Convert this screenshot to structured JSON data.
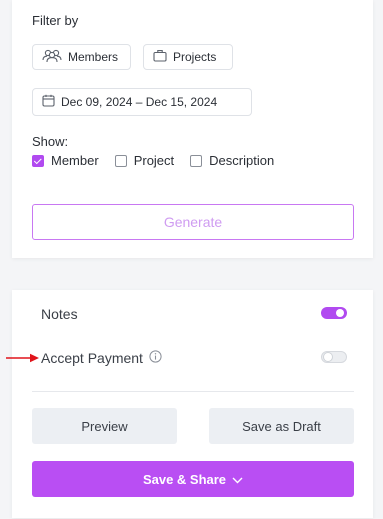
{
  "filter": {
    "label": "Filter by",
    "members_chip": "Members",
    "projects_chip": "Projects",
    "date_range": "Dec 09, 2024 – Dec 15, 2024"
  },
  "show": {
    "label": "Show:",
    "options": [
      {
        "label": "Member",
        "checked": true
      },
      {
        "label": "Project",
        "checked": false
      },
      {
        "label": "Description",
        "checked": false
      }
    ]
  },
  "generate_label": "Generate",
  "settings": {
    "notes_label": "Notes",
    "notes_enabled": true,
    "accept_payment_label": "Accept Payment",
    "accept_payment_enabled": false
  },
  "actions": {
    "preview_label": "Preview",
    "save_draft_label": "Save as Draft",
    "save_share_label": "Save & Share"
  },
  "colors": {
    "accent": "#b94ef3",
    "annotation_arrow": "#e0141b"
  },
  "icons": [
    "members-icon",
    "briefcase-icon",
    "calendar-icon",
    "info-icon",
    "chevron-down-icon"
  ]
}
